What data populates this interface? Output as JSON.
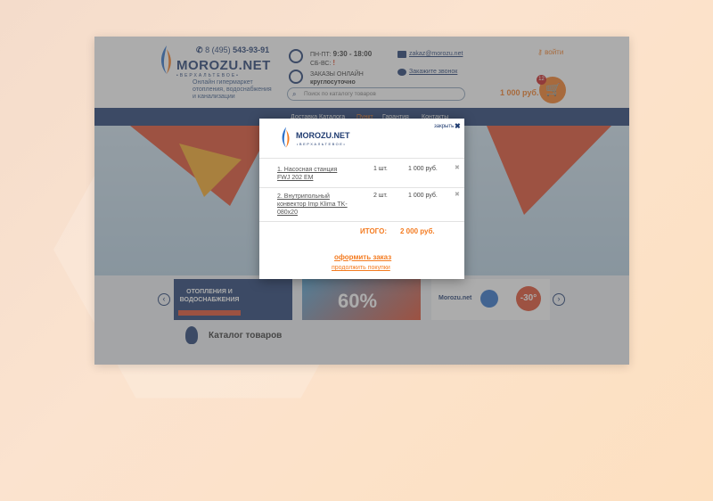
{
  "header": {
    "brand": "MOROZU.NET",
    "brand_sub": "•ВЕРХАЛЬТЕВОЕ•",
    "phone_prefix": "8 (495)",
    "phone_number": "543-93-91",
    "tagline": "Онлайн гипермаркет отопления, водоснабжения и канализации",
    "schedule_weekdays_label": "ПН-ПТ:",
    "schedule_weekdays_hours": "9:30 - 18:00",
    "schedule_weekend_label": "СБ-ВС:",
    "schedule_weekend_hours": "!",
    "orders_online": "ЗАКАЗЫ ОНЛАЙН",
    "orders_online_sub": "круглосуточно",
    "email": "zakaz@morozu.net",
    "callback": "Закажите звонок",
    "search_placeholder": "Поиск по каталогу товаров",
    "login": "войти",
    "cart_total": "1 000 руб.",
    "cart_count": "12"
  },
  "nav": {
    "items": [
      "Доставка",
      "Каталога",
      "Пункт",
      "Гарантия",
      "Контакты"
    ]
  },
  "carousel": {
    "card1_text": "ОТОПЛЕНИЯ И ВОДОСНАБЖЕНИЯ",
    "card2_text": "60%",
    "card3_brand": "Morozu.net",
    "card3_discount": "-30°"
  },
  "catalog": {
    "label": "Каталог товаров"
  },
  "modal": {
    "brand": "MOROZU.NET",
    "brand_sub": "•ВЕРХАЛЬТЕВОЕ•",
    "close_label": "закрыть",
    "items": [
      {
        "name": "1. Насосная станция FWJ 202 EM",
        "qty": "1 шт.",
        "price": "1 000 руб."
      },
      {
        "name": "2. Внутрипольный конвектор Imp Klima TK-080x20",
        "qty": "2 шт.",
        "price": "1 000 руб."
      }
    ],
    "total_label": "ИТОГО:",
    "total_value": "2 000 руб.",
    "checkout_label": "оформить заказ",
    "continue_label": "продолжить покупки"
  },
  "colors": {
    "brand_blue": "#1f3b70",
    "accent_orange": "#f47b20",
    "overlay": "#5a5a5a"
  }
}
